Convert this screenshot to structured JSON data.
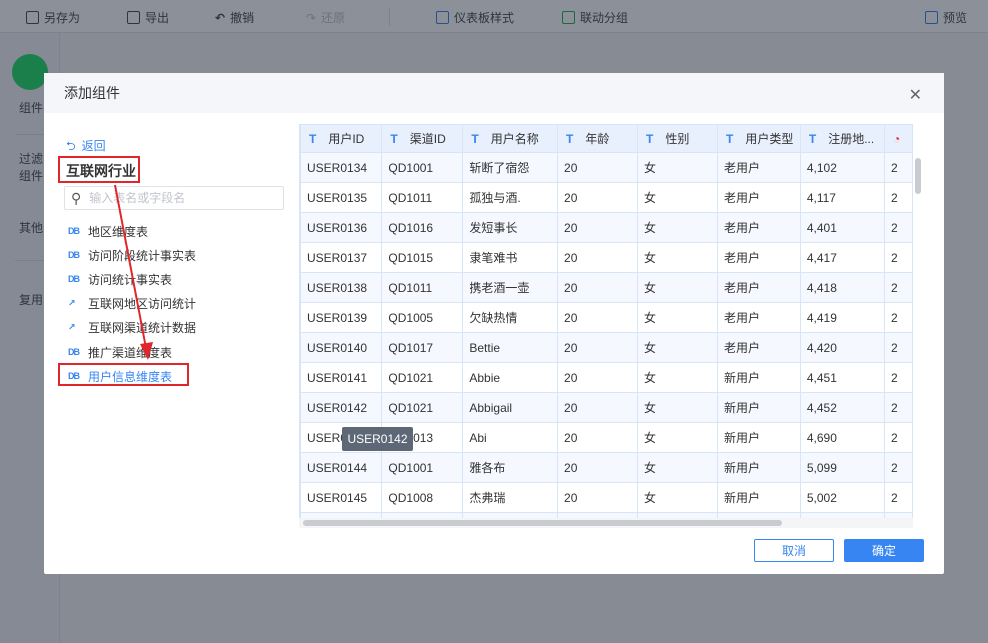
{
  "toolbar": {
    "save_as": "另存为",
    "export": "导出",
    "undo": "撤销",
    "redo": "还原",
    "dashboard_style": "仪表板样式",
    "linkage_group": "联动分组",
    "preview": "预览"
  },
  "sidebar": {
    "items": [
      "组件",
      "过滤组件",
      "其他",
      "复用"
    ]
  },
  "dialog": {
    "title": "添加组件",
    "back": "返回",
    "group": "互联网行业",
    "search_placeholder": "输入表名或字段名",
    "tables": [
      {
        "name": "地区维度表",
        "icon": "db-icon"
      },
      {
        "name": "访问阶段统计事实表",
        "icon": "db-icon"
      },
      {
        "name": "访问统计事实表",
        "icon": "db-icon"
      },
      {
        "name": "互联网地区访问统计",
        "icon": "analysis-icon"
      },
      {
        "name": "互联网渠道统计数据",
        "icon": "analysis-icon"
      },
      {
        "name": "推广渠道维度表",
        "icon": "db-icon"
      },
      {
        "name": "用户信息维度表",
        "icon": "db-icon",
        "selected": true
      }
    ],
    "columns": [
      "用户ID",
      "渠道ID",
      "用户名称",
      "年龄",
      "性别",
      "用户类型",
      "注册地..."
    ],
    "rows": [
      [
        "USER0134",
        "QD1001",
        "斩断了宿怨",
        "20",
        "女",
        "老用户",
        "4,102",
        "2"
      ],
      [
        "USER0135",
        "QD1011",
        "孤独与酒.",
        "20",
        "女",
        "老用户",
        "4,117",
        "2"
      ],
      [
        "USER0136",
        "QD1016",
        "发短事长",
        "20",
        "女",
        "老用户",
        "4,401",
        "2"
      ],
      [
        "USER0137",
        "QD1015",
        "隶笔难书",
        "20",
        "女",
        "老用户",
        "4,417",
        "2"
      ],
      [
        "USER0138",
        "QD1011",
        "携老酒一壶",
        "20",
        "女",
        "老用户",
        "4,418",
        "2"
      ],
      [
        "USER0139",
        "QD1005",
        "欠缺热情",
        "20",
        "女",
        "老用户",
        "4,419",
        "2"
      ],
      [
        "USER0140",
        "QD1017",
        "Bettie",
        "20",
        "女",
        "老用户",
        "4,420",
        "2"
      ],
      [
        "USER0141",
        "QD1021",
        "Abbie",
        "20",
        "女",
        "新用户",
        "4,451",
        "2"
      ],
      [
        "USER0142",
        "QD1021",
        "Abbigail",
        "20",
        "女",
        "新用户",
        "4,452",
        "2"
      ],
      [
        "USER0143",
        "QD1013",
        "Abi",
        "20",
        "女",
        "新用户",
        "4,690",
        "2"
      ],
      [
        "USER0144",
        "QD1001",
        "雅各布",
        "20",
        "女",
        "新用户",
        "5,099",
        "2"
      ],
      [
        "USER0145",
        "QD1008",
        "杰弗瑞",
        "20",
        "女",
        "新用户",
        "5,002",
        "2"
      ],
      [
        "",
        "",
        "",
        "",
        "",
        "",
        "",
        ""
      ]
    ],
    "tooltip": "USER0142",
    "cancel": "取消",
    "ok": "确定"
  },
  "colors": {
    "accent": "#3685f2",
    "annotation": "#e0262b",
    "add_button": "#1a7f4b"
  }
}
